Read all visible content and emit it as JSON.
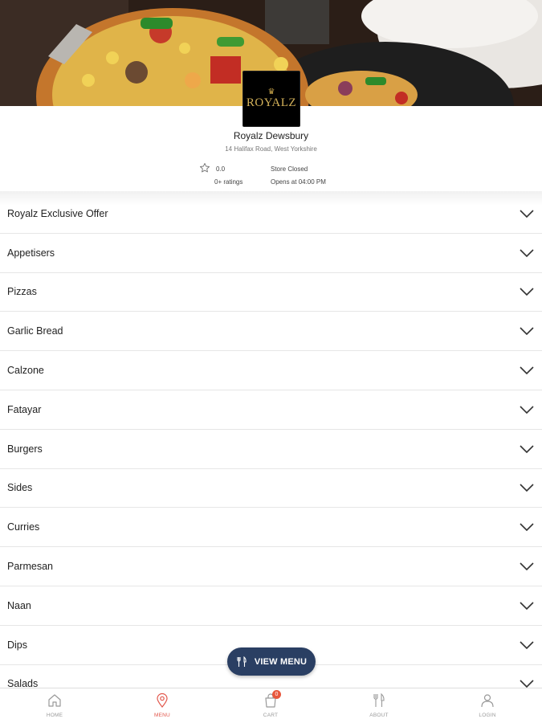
{
  "store": {
    "name": "Royalz Dewsbury",
    "address": "14 Halifax Road, West Yorkshire",
    "logo_text": "ROYALZ",
    "rating_value": "0.0",
    "rating_count": "0+ ratings",
    "status": "Store Closed",
    "opens": "Opens at 04:00 PM"
  },
  "categories": [
    {
      "label": "Royalz Exclusive Offer"
    },
    {
      "label": "Appetisers"
    },
    {
      "label": "Pizzas"
    },
    {
      "label": "Garlic Bread"
    },
    {
      "label": "Calzone"
    },
    {
      "label": "Fatayar"
    },
    {
      "label": "Burgers"
    },
    {
      "label": "Sides"
    },
    {
      "label": "Curries"
    },
    {
      "label": "Parmesan"
    },
    {
      "label": "Naan"
    },
    {
      "label": "Dips"
    },
    {
      "label": "Salads"
    }
  ],
  "view_menu": {
    "label": "VIEW MENU",
    "icon": "cutlery-icon"
  },
  "bottom_nav": {
    "items": [
      {
        "label": "HOME",
        "icon": "home-icon"
      },
      {
        "label": "MENU",
        "icon": "location-pin-icon",
        "active": true
      },
      {
        "label": "CART",
        "icon": "shopping-bag-icon",
        "badge": "0"
      },
      {
        "label": "ABOUT",
        "icon": "fork-knife-icon"
      },
      {
        "label": "LOGIN",
        "icon": "user-icon"
      }
    ]
  },
  "colors": {
    "accent": "#e2574c",
    "view_menu_bg": "#2a3f63",
    "badge": "#e8573d",
    "logo_gold": "#d4b25a"
  }
}
